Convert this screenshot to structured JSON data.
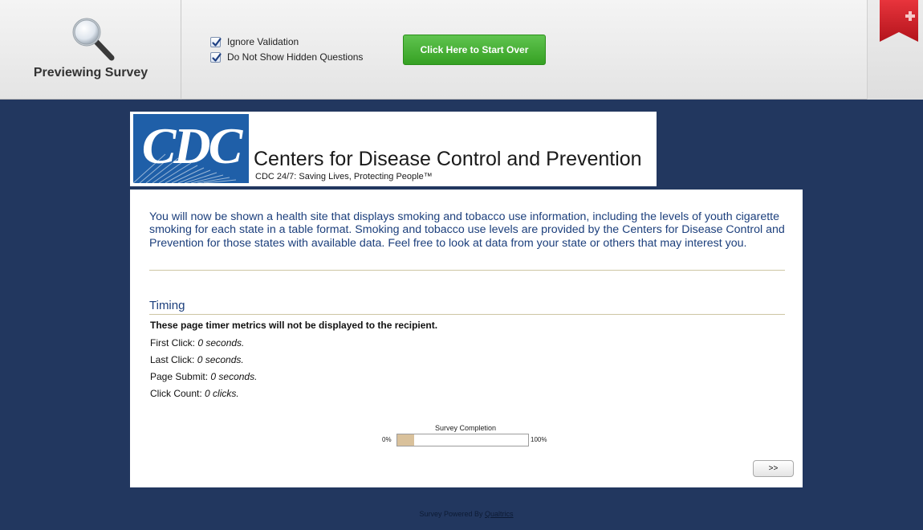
{
  "toolbar": {
    "preview_label": "Previewing Survey",
    "options": [
      {
        "label": "Ignore Validation",
        "checked": true
      },
      {
        "label": "Do Not Show Hidden Questions",
        "checked": true
      }
    ],
    "start_over_label": "Click Here to Start Over",
    "icons": [
      "magnifier-icon",
      "checkbox-checked-icon",
      "flag-plus-icon"
    ],
    "colors": {
      "start_over": "#3aa527",
      "flag": "#d9202a"
    }
  },
  "banner": {
    "logo_text": "CDC",
    "name": "Centers for Disease Control and Prevention",
    "tagline": "CDC 24/7: Saving Lives, Protecting People™",
    "logo_color": "#1f5fa8"
  },
  "survey": {
    "intro": "You will now be shown a health site that displays smoking and tobacco use information, including the levels of youth cigarette smoking for each state in a table format. Smoking and tobacco use levels are provided by the Centers for Disease Control and Prevention for those states with available data. Feel free to look at data from your state or others that may interest you.",
    "timing": {
      "title": "Timing",
      "note": "These page timer metrics will not be displayed to the recipient.",
      "metrics": [
        {
          "label": "First Click:",
          "value": "0 seconds."
        },
        {
          "label": "Last Click:",
          "value": "0 seconds."
        },
        {
          "label": "Page Submit:",
          "value": "0 seconds."
        },
        {
          "label": "Click Count:",
          "value": "0 clicks."
        }
      ]
    },
    "progress": {
      "title": "Survey Completion",
      "min_label": "0%",
      "max_label": "100%",
      "percent": 13
    },
    "next_label": ">>"
  },
  "footer": {
    "text": "Survey Powered By",
    "link": "Qualtrics"
  },
  "colors": {
    "page_background": "#22375f",
    "intro_text": "#1c3f7c",
    "progress_fill": "#d9c19b"
  }
}
